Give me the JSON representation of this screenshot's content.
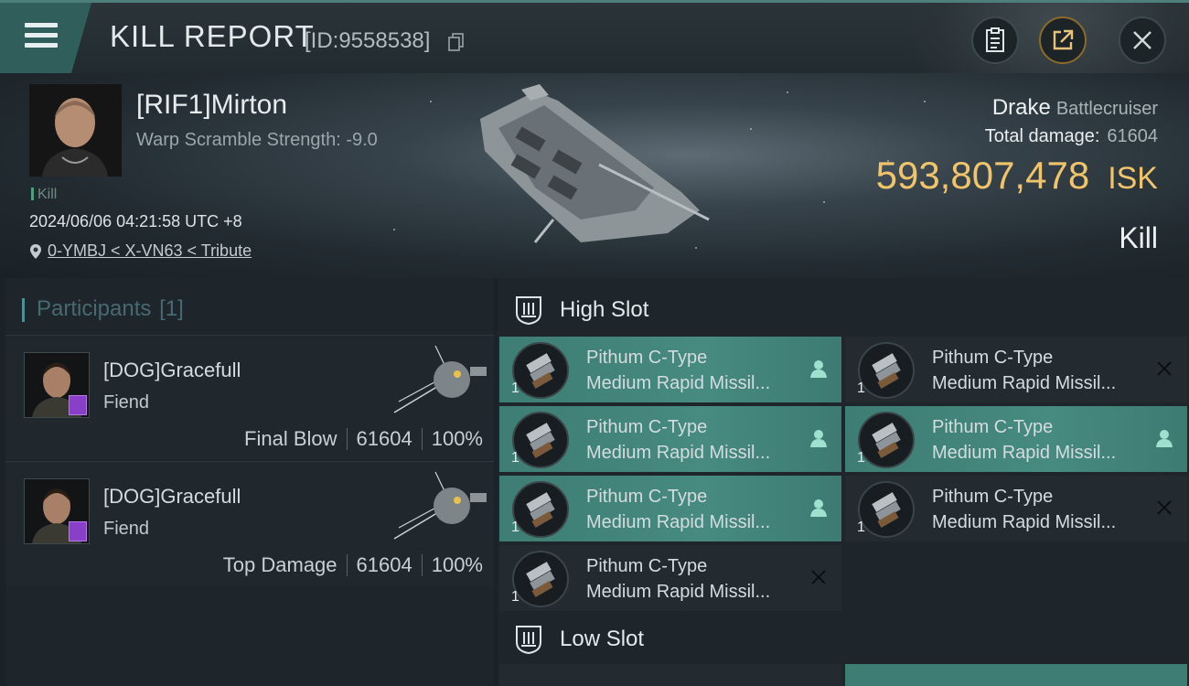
{
  "header": {
    "title": "KILL REPORT",
    "report_id": "[ID:9558538]",
    "icons": [
      "menu-icon",
      "copy-icon",
      "clipboard-icon",
      "share-icon",
      "close-icon"
    ]
  },
  "victim": {
    "name": "[RIF1]Mirton",
    "warp_scramble": "Warp Scramble Strength: -9.0",
    "tag": "Kill",
    "datetime": "2024/06/06 04:21:58 UTC +8",
    "location": "0-YMBJ < X-VN63 < Tribute",
    "ship": "Drake",
    "ship_class": "Battlecruiser",
    "total_damage_label": "Total damage:",
    "total_damage": "61604",
    "isk_value": "593,807,478",
    "isk_unit": "ISK",
    "result": "Kill"
  },
  "participants": {
    "title": "Participants",
    "count": "[1]",
    "rows": [
      {
        "name": "[DOG]Gracefull",
        "ship": "Fiend",
        "role": "Final Blow",
        "damage": "61604",
        "percent": "100%"
      },
      {
        "name": "[DOG]Gracefull",
        "ship": "Fiend",
        "role": "Top Damage",
        "damage": "61604",
        "percent": "100%"
      }
    ]
  },
  "slots": {
    "high": {
      "label": "High Slot",
      "modules": [
        {
          "line1": "Pithum C-Type",
          "line2": "Medium Rapid Missil...",
          "qty": "1",
          "status": "fitted"
        },
        {
          "line1": "Pithum C-Type",
          "line2": "Medium Rapid Missil...",
          "qty": "1",
          "status": "destroyed"
        },
        {
          "line1": "Pithum C-Type",
          "line2": "Medium Rapid Missil...",
          "qty": "1",
          "status": "fitted"
        },
        {
          "line1": "Pithum C-Type",
          "line2": "Medium Rapid Missil...",
          "qty": "1",
          "status": "fitted"
        },
        {
          "line1": "Pithum C-Type",
          "line2": "Medium Rapid Missil...",
          "qty": "1",
          "status": "fitted"
        },
        {
          "line1": "Pithum C-Type",
          "line2": "Medium Rapid Missil...",
          "qty": "1",
          "status": "destroyed"
        },
        {
          "line1": "Pithum C-Type",
          "line2": "Medium Rapid Missil...",
          "qty": "1",
          "status": "destroyed"
        }
      ]
    },
    "low": {
      "label": "Low Slot"
    }
  },
  "colors": {
    "accent_teal": "#468a80",
    "isk_gold": "#f0c46a",
    "badge_purple": "#8a3fc9"
  }
}
